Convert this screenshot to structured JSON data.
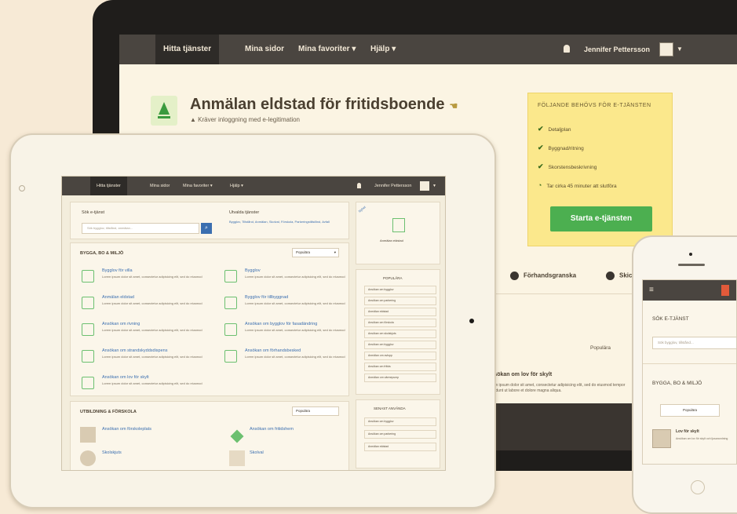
{
  "colors": {
    "accent": "#4caf50",
    "nav": "#4a4540",
    "highlight": "#fbe88c",
    "search_button": "#3b6fb0"
  },
  "laptop": {
    "nav": {
      "items": [
        "Hitta tjänster",
        "Mina sidor",
        "Mina favoriter",
        "Hjälp"
      ],
      "user": "Jennifer Pettersson"
    },
    "title": "Anmälan eldstad för fritidsboende",
    "subtitle": "Kräver inloggning med e-legitimation",
    "box": {
      "title": "FÖLJANDE BEHÖVS FÖR E-TJÄNSTEN",
      "checklist": [
        "Detaljplan",
        "Byggnad/ritning",
        "Skorstensbeskrivning",
        "Tar cirka 45 minuter att slutföra"
      ],
      "start_button": "Starta e-tjänsten"
    },
    "steps": [
      "Förhandsgranska",
      "Skicka"
    ],
    "popular": "Populära",
    "snippet_title": "Ansökan om lov för skylt",
    "snippet_text": "Lorem ipsum dolor sit amet, consectetur adipisicing elit, sed do eiusmod tempor incididunt ut labore et dolore magna aliqua."
  },
  "tablet": {
    "nav": {
      "items": [
        "Hitta tjänster",
        "Mina sidor",
        "Mina favoriter",
        "Hjälp"
      ],
      "user": "Jennifer Pettersson"
    },
    "search": {
      "label": "Sök e-tjänst",
      "placeholder": "Sök bygglov, tillstånd, anmälan..."
    },
    "recent": {
      "title": "Utvalda tjänster",
      "text": "Bygglov, Tillstånd, Anmälan, Skolval, Förskola, Parkeringstillstånd, Avfall"
    },
    "section1": {
      "title": "BYGGA, BO & MILJÖ",
      "select": "Populära",
      "services": [
        "Bygglov för villa",
        "Bygglov",
        "Anmälan eldstad",
        "Bygglov för tillbyggnad",
        "Ansökan om rivning",
        "Ansökan om bygglov för fasadändring",
        "Ansökan om strandskyddsdispens",
        "Ansökan om förhandsbesked",
        "Ansökan om lov för skylt"
      ],
      "desc": "Lorem ipsum dolor sit amet, consectetur adipisicing elit, sed do eiusmod"
    },
    "section2": {
      "title": "UTBILDNING & FÖRSKOLA",
      "select": "Populära",
      "services": [
        "Ansökan om förskoleplats",
        "Skolskjuts",
        "Ansökan om fritidshem",
        "Skolval"
      ]
    },
    "side": {
      "badge": "Nyhet",
      "featured": "Anmälan eldstad",
      "popular_title": "POPULÄRA",
      "popular": [
        "Ansökan om bygglov",
        "Ansökan om parkering",
        "Anmälan eldstad",
        "Ansökan om förskola",
        "Ansökan om skolskjuts",
        "Ansökan om bygglov",
        "Anmälan om avlopp",
        "Ansökan om fritids",
        "Anmälan om värmepump"
      ],
      "recent_title": "SENAST ANVÄNDA",
      "recent": [
        "Ansökan om bygglov",
        "Ansökan om parkering",
        "Anmälan eldstad"
      ]
    }
  },
  "phone": {
    "search_label": "SÖK E-TJÄNST",
    "search_placeholder": "Sök bygglov, tillstånd...",
    "section": "BYGGA, BO & MILJÖ",
    "select": "Populära",
    "item_title": "Lov för skylt",
    "item_text": "Ansökan om lov för skylt och ljusanordning"
  }
}
